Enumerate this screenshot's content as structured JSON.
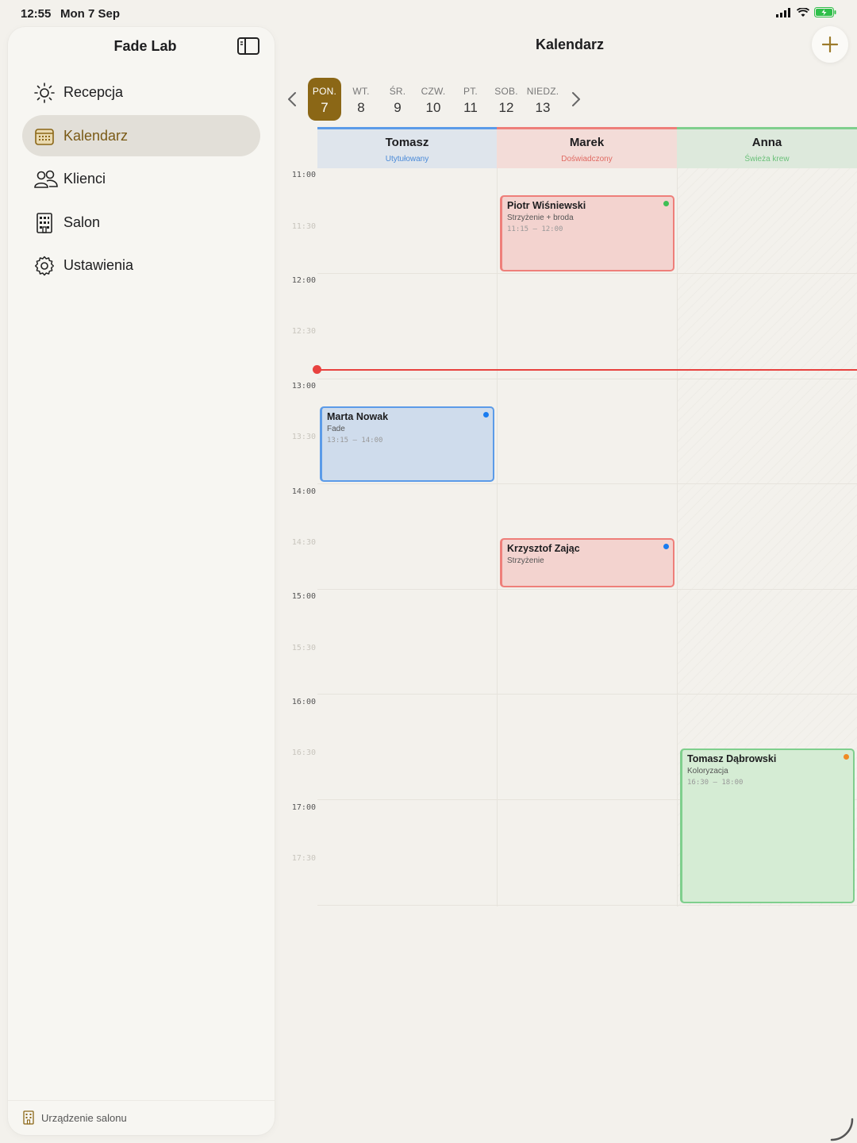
{
  "status_bar": {
    "time": "12:55",
    "date": "Mon 7 Sep"
  },
  "sidebar": {
    "title": "Fade Lab",
    "items": [
      {
        "label": "Recepcja",
        "icon": "sun-icon",
        "active": false
      },
      {
        "label": "Kalendarz",
        "icon": "calendar-icon",
        "active": true
      },
      {
        "label": "Klienci",
        "icon": "people-icon",
        "active": false
      },
      {
        "label": "Salon",
        "icon": "building-icon",
        "active": false
      },
      {
        "label": "Ustawienia",
        "icon": "gear-icon",
        "active": false
      }
    ],
    "footer": "Urządzenie salonu"
  },
  "main": {
    "title": "Kalendarz",
    "week": [
      {
        "name": "PON.",
        "num": "7",
        "active": true
      },
      {
        "name": "WT.",
        "num": "8"
      },
      {
        "name": "ŚR.",
        "num": "9"
      },
      {
        "name": "CZW.",
        "num": "10"
      },
      {
        "name": "PT.",
        "num": "11"
      },
      {
        "name": "SOB.",
        "num": "12"
      },
      {
        "name": "NIEDZ.",
        "num": "13"
      }
    ],
    "columns": [
      {
        "name": "Tomasz",
        "subtitle": "Utytułowany",
        "color": "#5b9be8",
        "bg": "#dfe5ec",
        "sub_color": "#4a8ad8"
      },
      {
        "name": "Marek",
        "subtitle": "Doświadczony",
        "color": "#ee7f7a",
        "bg": "#f3dcd8",
        "sub_color": "#e06a62"
      },
      {
        "name": "Anna",
        "subtitle": "Świeża krew",
        "color": "#7fcf8d",
        "bg": "#dde9dc",
        "sub_color": "#6ac079"
      }
    ],
    "times": [
      "11:00",
      "11:30",
      "12:00",
      "12:30",
      "13:00",
      "13:30",
      "14:00",
      "14:30",
      "15:00",
      "15:30",
      "16:00",
      "16:30",
      "17:00",
      "17:30"
    ],
    "appointments": [
      {
        "client": "Piotr Wiśniewski",
        "service": "Strzyżenie + broda",
        "time": "11:15 – 12:00",
        "dot": "#3fbf55"
      },
      {
        "client": "Marta Nowak",
        "service": "Fade",
        "time": "13:15 – 14:00",
        "dot": "#1a7cf0"
      },
      {
        "client": "Krzysztof Zając",
        "service": "Strzyżenie",
        "time": "",
        "dot": "#1a7cf0"
      },
      {
        "client": "Tomasz Dąbrowski",
        "service": "Koloryzacja",
        "time": "16:30 – 18:00",
        "dot": "#f08a24"
      }
    ]
  },
  "colors": {
    "accent": "#8b6716",
    "now_line": "#e8423f"
  }
}
